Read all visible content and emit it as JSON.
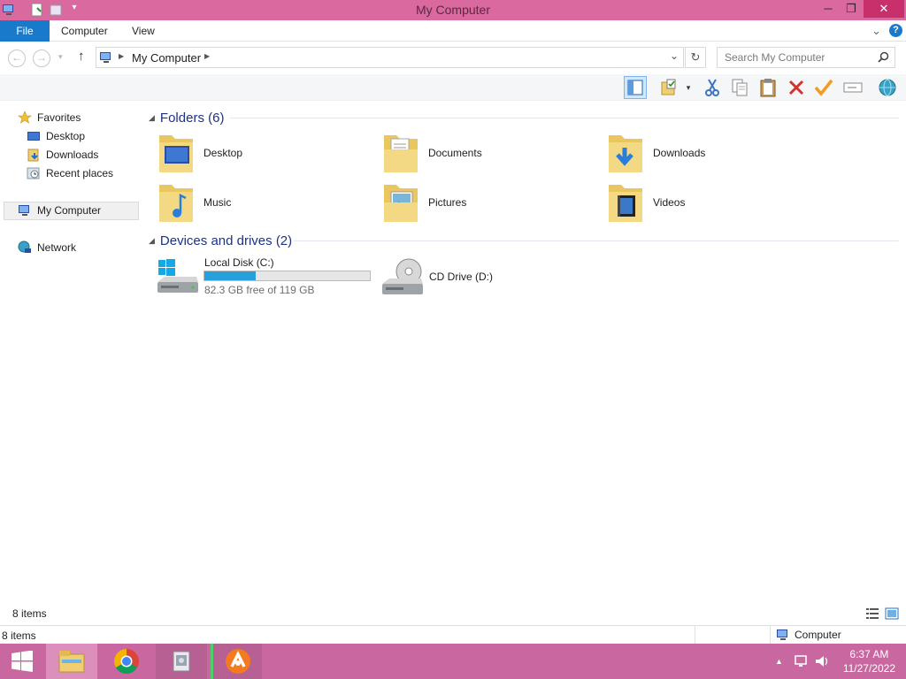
{
  "window": {
    "title": "My Computer",
    "minimize_glyph": "─",
    "restore_glyph": "❐",
    "close_glyph": "✕"
  },
  "ribbon": {
    "tabs": [
      {
        "label": "File"
      },
      {
        "label": "Computer"
      },
      {
        "label": "View"
      }
    ],
    "help_glyph": "?",
    "expand_glyph": "⌄"
  },
  "address": {
    "back_glyph": "←",
    "forward_glyph": "→",
    "up_glyph": "↑",
    "path": "My Computer",
    "refresh_glyph": "↻",
    "search_placeholder": "Search My Computer"
  },
  "toolbar": {
    "buttons": [
      {
        "icon": "preview-pane-icon",
        "selected": true
      },
      {
        "icon": "folder-properties-icon"
      },
      {
        "icon": "cut-icon"
      },
      {
        "icon": "copy-icon"
      },
      {
        "icon": "paste-icon"
      },
      {
        "icon": "delete-icon"
      },
      {
        "icon": "checkmark-icon"
      },
      {
        "icon": "rename-icon"
      },
      {
        "icon": "network-globe-icon"
      }
    ]
  },
  "nav": {
    "favorites": "Favorites",
    "desktop": "Desktop",
    "downloads": "Downloads",
    "recent": "Recent places",
    "computer": "My Computer",
    "network": "Network"
  },
  "content": {
    "folders_header": "Folders (6)",
    "folders": [
      {
        "label": "Desktop",
        "icon": "desktop-folder-icon"
      },
      {
        "label": "Documents",
        "icon": "documents-folder-icon"
      },
      {
        "label": "Downloads",
        "icon": "downloads-folder-icon"
      },
      {
        "label": "Music",
        "icon": "music-folder-icon"
      },
      {
        "label": "Pictures",
        "icon": "pictures-folder-icon"
      },
      {
        "label": "Videos",
        "icon": "videos-folder-icon"
      }
    ],
    "drives_header": "Devices and drives (2)",
    "drives": [
      {
        "label": "Local Disk (C:)",
        "free_text": "82.3 GB free of 119 GB",
        "used_fraction": 0.31,
        "icon": "windows-drive-icon"
      },
      {
        "label": "CD Drive (D:)",
        "icon": "cd-drive-icon"
      }
    ]
  },
  "status": {
    "items": "8 items",
    "details_items": "8 items",
    "details_location": "Computer"
  },
  "taskbar": {
    "apps": [
      {
        "icon": "start-icon"
      },
      {
        "icon": "file-explorer-icon"
      },
      {
        "icon": "chrome-icon"
      },
      {
        "icon": "app-icon"
      },
      {
        "icon": "avast-icon"
      }
    ],
    "time": "6:37 AM",
    "date": "11/27/2022"
  },
  "colors": {
    "accent": "#1979ca",
    "titlebar": "#d9699e",
    "taskbar": "#c867a0",
    "header_text": "#1e3287",
    "bar_fill": "#26a0da"
  }
}
